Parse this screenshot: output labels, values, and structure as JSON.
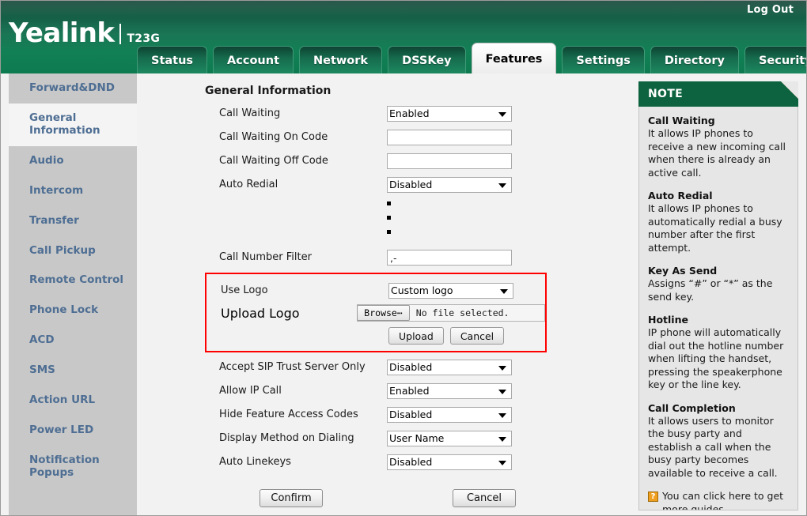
{
  "header": {
    "logout_label": "Log Out",
    "brand": "Yealink",
    "model": "T23G",
    "tabs": [
      {
        "label": "Status",
        "active": false
      },
      {
        "label": "Account",
        "active": false
      },
      {
        "label": "Network",
        "active": false
      },
      {
        "label": "DSSKey",
        "active": false
      },
      {
        "label": "Features",
        "active": true
      },
      {
        "label": "Settings",
        "active": false
      },
      {
        "label": "Directory",
        "active": false
      },
      {
        "label": "Security",
        "active": false
      }
    ]
  },
  "sidebar": {
    "items": [
      {
        "label": "Forward&DND",
        "active": false
      },
      {
        "label": "General Information",
        "active": true
      },
      {
        "label": "Audio",
        "active": false
      },
      {
        "label": "Intercom",
        "active": false
      },
      {
        "label": "Transfer",
        "active": false
      },
      {
        "label": "Call Pickup",
        "active": false
      },
      {
        "label": "Remote Control",
        "active": false
      },
      {
        "label": "Phone Lock",
        "active": false
      },
      {
        "label": "ACD",
        "active": false
      },
      {
        "label": "SMS",
        "active": false
      },
      {
        "label": "Action URL",
        "active": false
      },
      {
        "label": "Power LED",
        "active": false
      },
      {
        "label": "Notification Popups",
        "active": false
      }
    ]
  },
  "main": {
    "section_title": "General Information",
    "rows_top": [
      {
        "label": "Call Waiting",
        "type": "select",
        "value": "Enabled"
      },
      {
        "label": "Call Waiting On Code",
        "type": "text",
        "value": ""
      },
      {
        "label": "Call Waiting Off Code",
        "type": "text",
        "value": ""
      },
      {
        "label": "Auto Redial",
        "type": "select",
        "value": "Disabled"
      }
    ],
    "call_number_filter": {
      "label": "Call Number Filter",
      "type": "text",
      "value": ",-"
    },
    "logo_box": {
      "use_logo": {
        "label": "Use Logo",
        "value": "Custom logo"
      },
      "upload_logo": {
        "label": "Upload Logo",
        "browse_label": "Browse⋯",
        "file_status": "No file selected.",
        "upload_label": "Upload",
        "cancel_label": "Cancel"
      },
      "highlight_color": "#ff0000"
    },
    "rows_bottom": [
      {
        "label": "Accept SIP Trust Server Only",
        "type": "select",
        "value": "Disabled"
      },
      {
        "label": "Allow IP Call",
        "type": "select",
        "value": "Enabled"
      },
      {
        "label": "Hide Feature Access Codes",
        "type": "select",
        "value": "Disabled"
      },
      {
        "label": "Display Method on Dialing",
        "type": "select",
        "value": "User Name"
      },
      {
        "label": "Auto Linekeys",
        "type": "select",
        "value": "Disabled"
      }
    ],
    "confirm_label": "Confirm",
    "cancel_label": "Cancel"
  },
  "note": {
    "title": "NOTE",
    "sections": [
      {
        "heading": "Call Waiting",
        "text": "It allows IP phones to receive a new incoming call when there is already an active call."
      },
      {
        "heading": "Auto Redial",
        "text": "It allows IP phones to automatically redial a busy number after the first attempt."
      },
      {
        "heading": "Key As Send",
        "text": "Assigns “#” or “*” as the send key."
      },
      {
        "heading": "Hotline",
        "text": "IP phone will automatically dial out the hotline number when lifting the handset, pressing the speakerphone key or the line key."
      },
      {
        "heading": "Call Completion",
        "text": "It allows users to monitor the busy party and establish a call when the busy party becomes available to receive a call."
      }
    ],
    "link_icon": "help-icon",
    "link_text": "You can click here to get more guides."
  },
  "colors": {
    "brand_green": "#0d6340",
    "accent_orange": "#f07b12",
    "highlight_red": "#ff0000",
    "sidebar_link": "#4e6e93"
  }
}
